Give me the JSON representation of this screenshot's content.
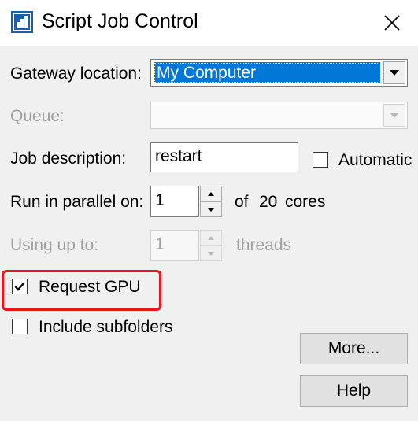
{
  "window": {
    "title": "Script Job Control"
  },
  "form": {
    "gateway_label": "Gateway location:",
    "gateway_value": "My Computer",
    "queue_label": "Queue:",
    "queue_value": "",
    "job_description_label": "Job description:",
    "job_description_value": "restart",
    "automatic_label": "Automatic",
    "automatic_checked": false,
    "run_parallel_label": "Run in parallel on:",
    "run_parallel_value": "1",
    "of_text": "of",
    "cores_count": "20",
    "cores_text": "cores",
    "using_up_to_label": "Using up to:",
    "threads_value": "1",
    "threads_text": "threads",
    "request_gpu_label": "Request GPU",
    "request_gpu_checked": true,
    "include_subfolders_label": "Include subfolders",
    "include_subfolders_checked": false
  },
  "buttons": {
    "more_label": "More...",
    "help_label": "Help"
  },
  "colors": {
    "selection": "#0078d7",
    "highlight_annotation": "#e8151b",
    "dialog_background": "#f0f0f0",
    "disabled_text": "#a0a0a0"
  },
  "icons": {
    "app": "app-window-icon",
    "close": "close-icon",
    "dropdown": "chevron-down-icon",
    "spin_up": "spin-up-icon",
    "spin_down": "spin-down-icon",
    "check": "checkmark-icon"
  }
}
